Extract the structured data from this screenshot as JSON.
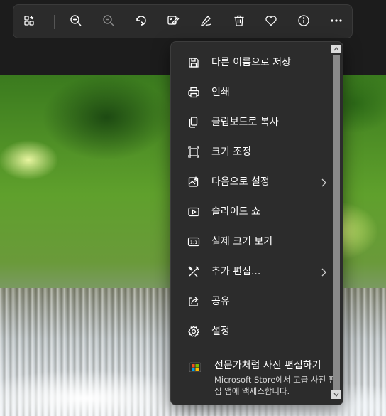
{
  "toolbar": {
    "buttons": [
      {
        "name": "gallery-icon"
      },
      {
        "name": "zoom-in-icon"
      },
      {
        "name": "zoom-out-icon"
      },
      {
        "name": "rotate-icon"
      },
      {
        "name": "edit-image-icon"
      },
      {
        "name": "draw-icon"
      },
      {
        "name": "delete-icon"
      },
      {
        "name": "favorite-icon"
      },
      {
        "name": "info-icon"
      },
      {
        "name": "more-options-icon"
      }
    ]
  },
  "menu": {
    "items": [
      {
        "label": "다른 이름으로 저장",
        "icon": "save-icon"
      },
      {
        "label": "인쇄",
        "icon": "print-icon"
      },
      {
        "label": "클립보드로 복사",
        "icon": "copy-icon"
      },
      {
        "label": "크기 조정",
        "icon": "resize-icon"
      },
      {
        "label": "다음으로 설정",
        "icon": "set-as-icon",
        "submenu": true
      },
      {
        "label": "슬라이드 쇼",
        "icon": "slideshow-icon"
      },
      {
        "label": "실제 크기 보기",
        "icon": "actual-size-icon"
      },
      {
        "label": "추가 편집...",
        "icon": "more-edit-icon",
        "submenu": true
      },
      {
        "label": "공유",
        "icon": "share-icon"
      },
      {
        "label": "설정",
        "icon": "settings-icon"
      }
    ],
    "promo": {
      "title": "전문가처럼 사진 편집하기",
      "description": "Microsoft Store에서 고급 사진 편집 앱에 액세스합니다.",
      "icon": "microsoft-store-icon"
    }
  },
  "colors": {
    "menu_bg": "#2c2c2c",
    "toolbar_bg": "#2b2b2b",
    "text": "#ffffff",
    "subtext": "#d8d8d8"
  }
}
